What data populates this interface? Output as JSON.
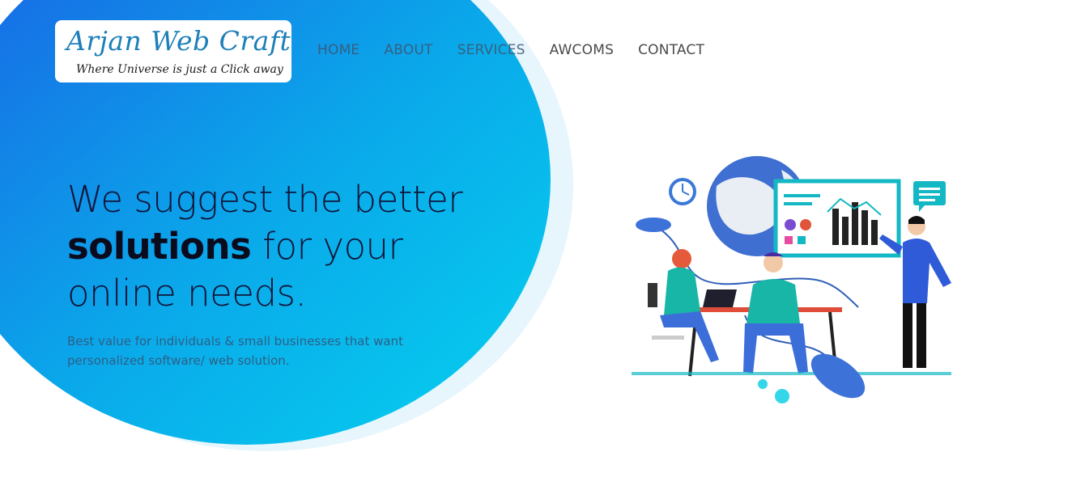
{
  "logo": {
    "title": "Arjan Web Craft",
    "tagline": "Where Universe is just a Click away"
  },
  "nav": {
    "items": [
      "HOME",
      "ABOUT",
      "SERVICES",
      "AWCOMS",
      "CONTACT"
    ]
  },
  "hero": {
    "headline_line1": "We suggest the better",
    "headline_bold": "solutions",
    "headline_line2_rest": " for your",
    "headline_line3": "online needs.",
    "subtext": "Best value for individuals & small businesses that want personalized software/ web solution."
  },
  "colors": {
    "gradient_start": "#1a6ee6",
    "gradient_end": "#06cdee",
    "logo_blue": "#1c7fb8",
    "headline": "#10153a"
  },
  "illustration": {
    "icons": [
      "globe-icon",
      "clock-icon",
      "chart-board-icon",
      "chat-bubble-icon",
      "laptop-icon",
      "mouse-icon",
      "person-icon"
    ]
  }
}
